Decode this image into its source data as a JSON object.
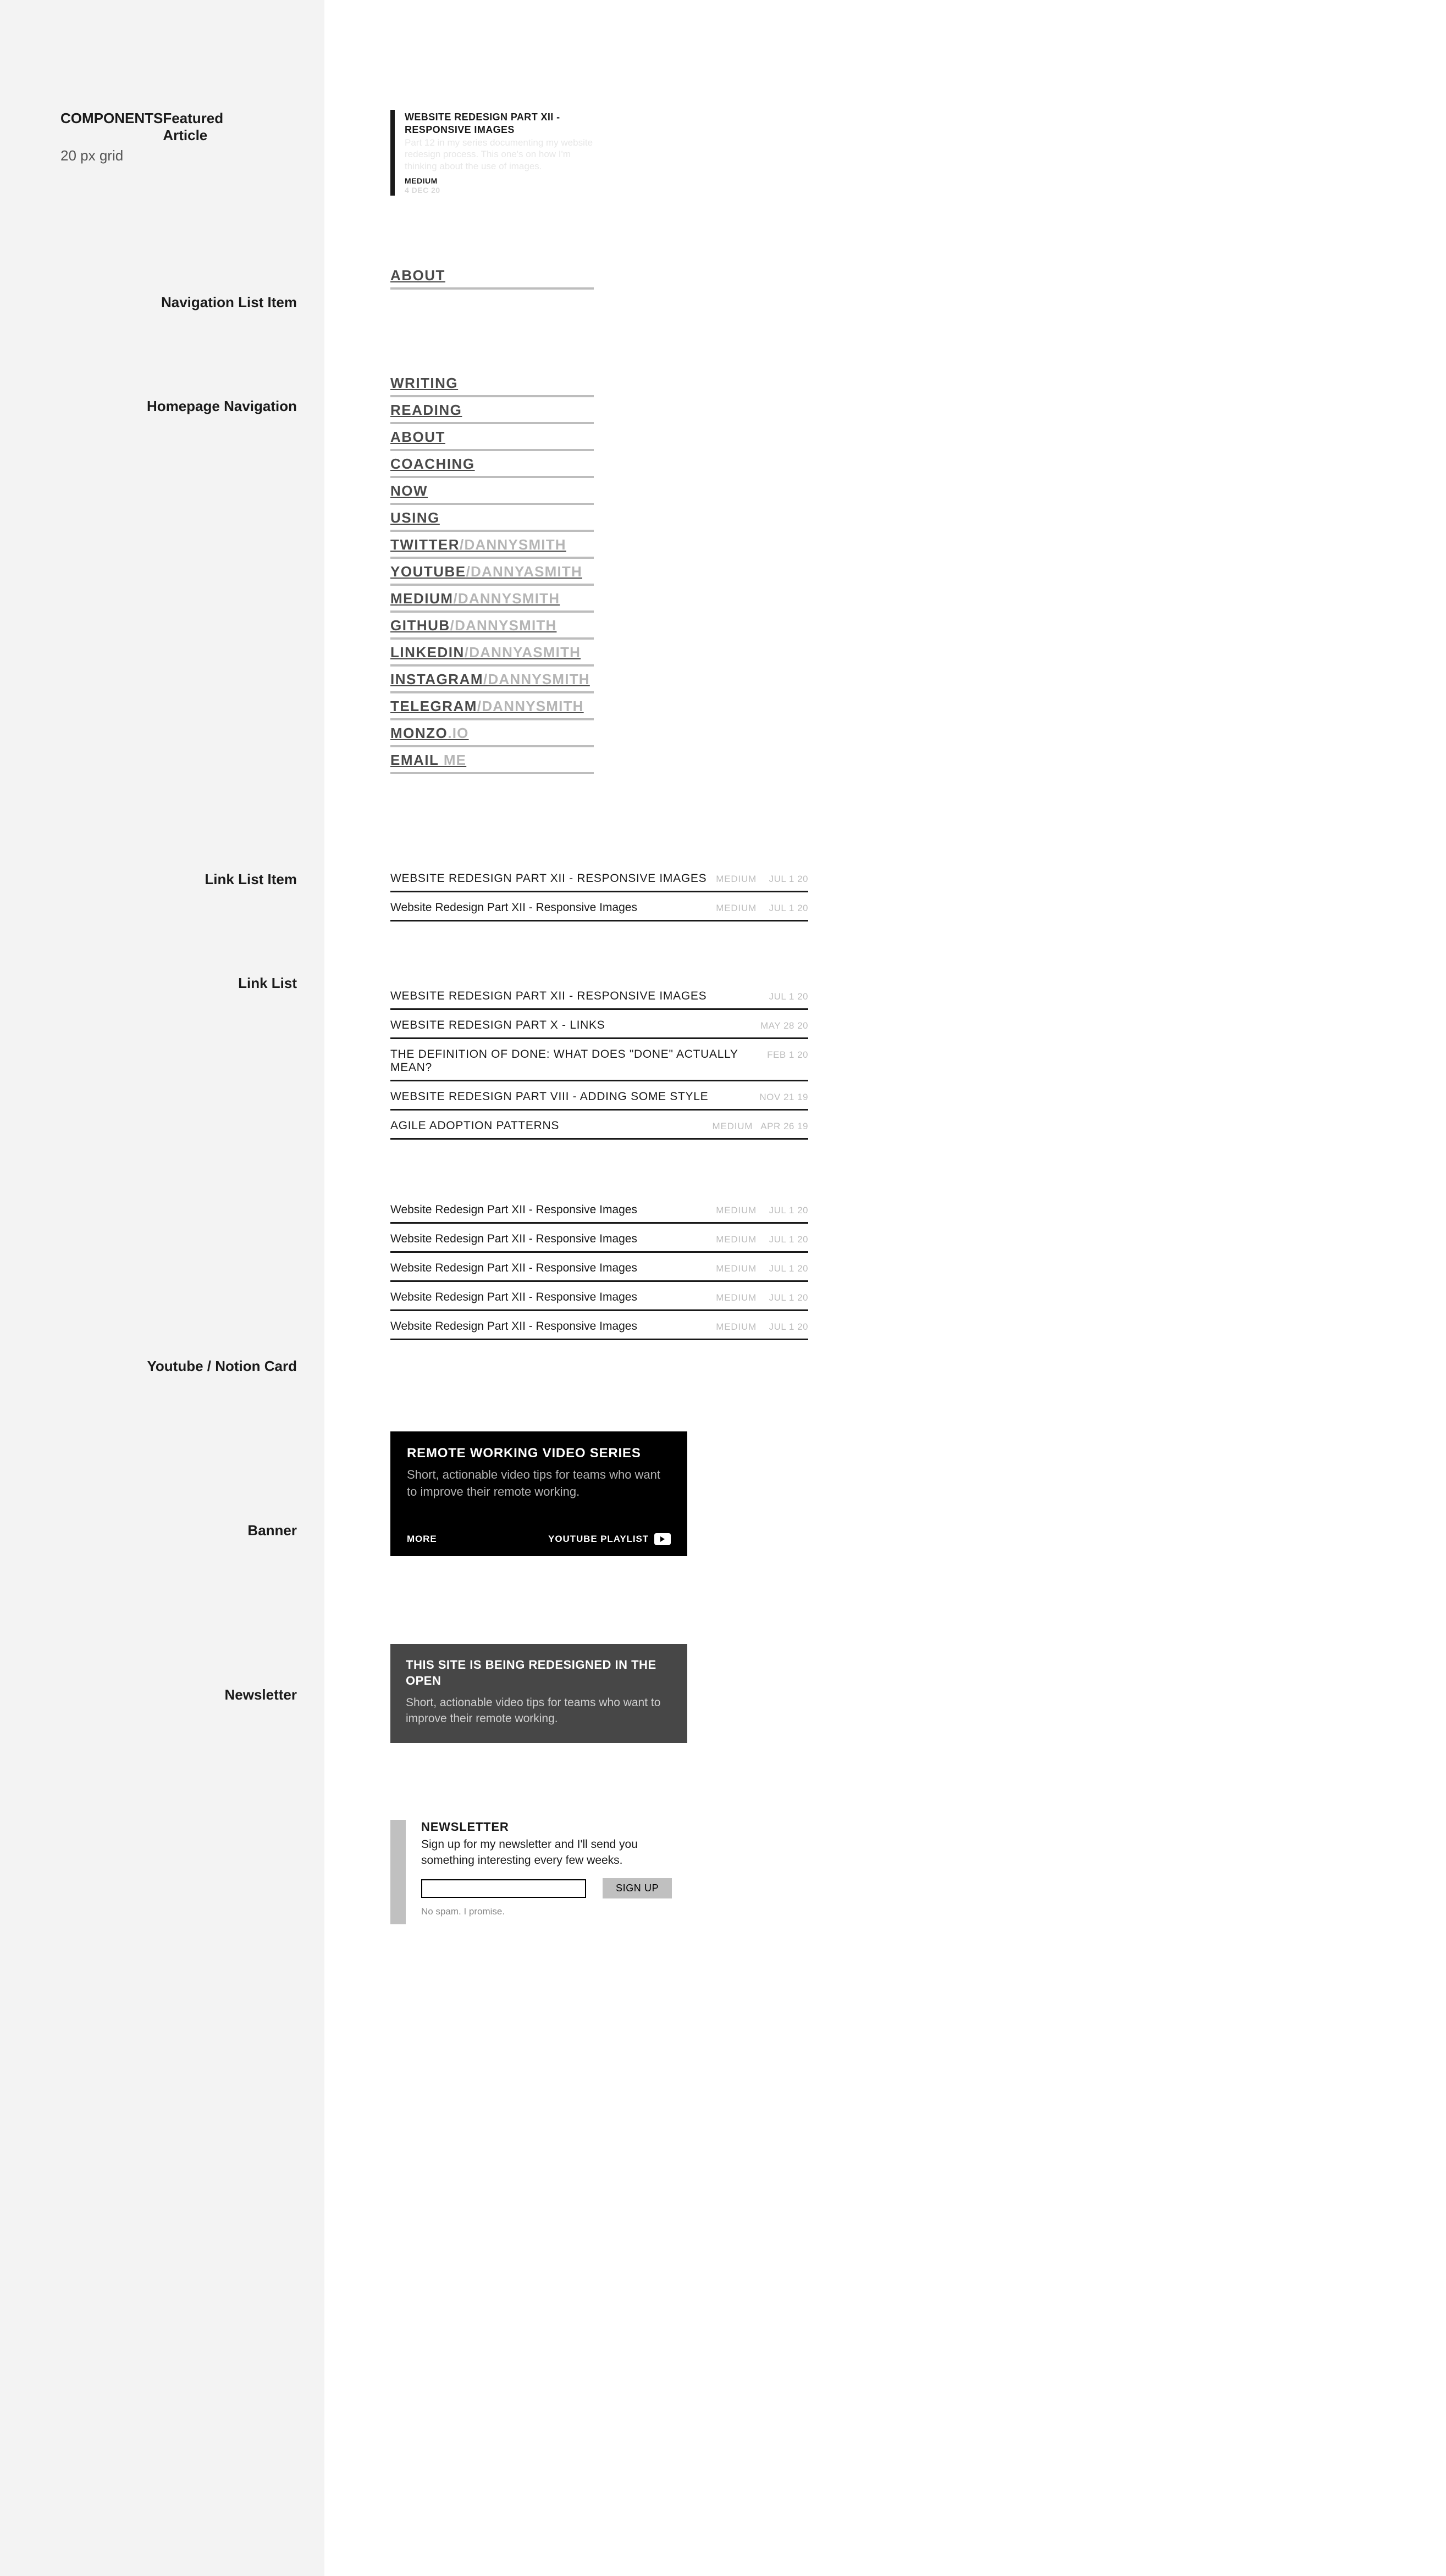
{
  "header": {
    "components_label": "COMPONENTS",
    "featured_label": "Featured Article",
    "grid_note": "20 px grid",
    "labels": {
      "nav_item": "Navigation List Item",
      "homepage_nav": "Homepage Navigation",
      "link_list_item": "Link List Item",
      "link_list": "Link List",
      "yt_card": "Youtube / Notion Card",
      "banner": "Banner",
      "newsletter": "Newsletter"
    }
  },
  "featured": {
    "title": "WEBSITE REDESIGN PART XII - RESPONSIVE IMAGES",
    "desc": "Part 12 in my series documenting my website redesign process. This one's on how I'm thinking about the use of images.",
    "source": "MEDIUM",
    "date": "4 DEC 20"
  },
  "nav_single": {
    "label": "ABOUT"
  },
  "nav_items": [
    {
      "label": "WRITING",
      "user": ""
    },
    {
      "label": "READING",
      "user": ""
    },
    {
      "label": "ABOUT",
      "user": ""
    },
    {
      "label": "COACHING",
      "user": ""
    },
    {
      "label": "NOW",
      "user": ""
    },
    {
      "label": "USING",
      "user": ""
    },
    {
      "label": "TWITTER",
      "user": "/DANNYSMITH"
    },
    {
      "label": "YOUTUBE",
      "user": "/DANNYASMITH"
    },
    {
      "label": "MEDIUM",
      "user": "/DANNYSMITH"
    },
    {
      "label": "GITHUB",
      "user": "/DANNYSMITH"
    },
    {
      "label": "LINKEDIN",
      "user": "/DANNYASMITH"
    },
    {
      "label": "INSTAGRAM",
      "user": "/DANNYSMITH"
    },
    {
      "label": "TELEGRAM",
      "user": "/DANNYSMITH"
    },
    {
      "label": "MONZO",
      "user": ".IO"
    },
    {
      "label": "EMAIL",
      "user": " ME"
    }
  ],
  "link_item_demo": {
    "upper": {
      "title": "WEBSITE REDESIGN PART XII - RESPONSIVE IMAGES",
      "source": "MEDIUM",
      "date": "JUL 1 20"
    },
    "normal": {
      "title": "Website Redesign Part XII - Responsive Images",
      "source": "MEDIUM",
      "date": "JUL 1 20"
    }
  },
  "link_list_upper": [
    {
      "title": "WEBSITE REDESIGN PART XII - RESPONSIVE IMAGES",
      "source": "",
      "date": "JUL 1 20"
    },
    {
      "title": "WEBSITE REDESIGN PART X - LINKS",
      "source": "",
      "date": "MAY 28 20"
    },
    {
      "title": "THE DEFINITION OF DONE: WHAT DOES \"DONE\" ACTUALLY MEAN?",
      "source": "",
      "date": "FEB 1 20"
    },
    {
      "title": "WEBSITE REDESIGN PART VIII - ADDING SOME STYLE",
      "source": "",
      "date": "NOV 21 19"
    },
    {
      "title": "AGILE ADOPTION PATTERNS",
      "source": "MEDIUM",
      "date": "APR 26 19"
    }
  ],
  "link_list_normal": [
    {
      "title": "Website Redesign Part XII - Responsive Images",
      "source": "MEDIUM",
      "date": "JUL 1 20"
    },
    {
      "title": "Website Redesign Part XII - Responsive Images",
      "source": "MEDIUM",
      "date": "JUL 1 20"
    },
    {
      "title": "Website Redesign Part XII - Responsive Images",
      "source": "MEDIUM",
      "date": "JUL 1 20"
    },
    {
      "title": "Website Redesign Part XII - Responsive Images",
      "source": "MEDIUM",
      "date": "JUL 1 20"
    },
    {
      "title": "Website Redesign Part XII - Responsive Images",
      "source": "MEDIUM",
      "date": "JUL 1 20"
    }
  ],
  "yt_card": {
    "title": "REMOTE WORKING VIDEO SERIES",
    "desc": "Short, actionable video tips for teams who want to improve their remote working.",
    "more": "MORE",
    "link_label": "YOUTUBE PLAYLIST"
  },
  "banner": {
    "title": "THIS SITE IS BEING REDESIGNED IN THE OPEN",
    "desc": "Short, actionable video tips for teams who want to improve their remote working."
  },
  "newsletter": {
    "title": "NEWSLETTER",
    "desc": "Sign up for my newsletter and I'll send you something interesting every few weeks.",
    "button": "SIGN UP",
    "footer": "No spam. I promise."
  }
}
